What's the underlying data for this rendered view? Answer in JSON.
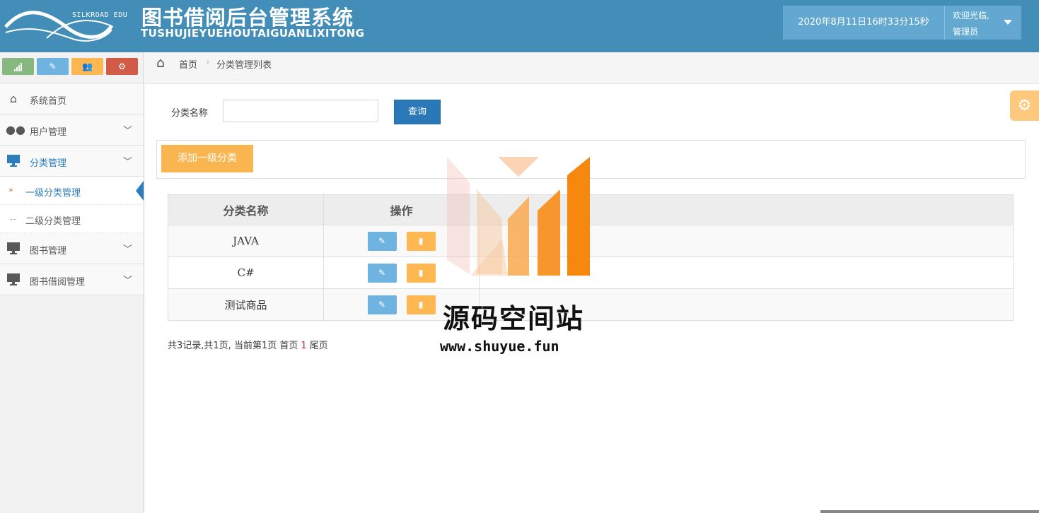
{
  "header": {
    "logo_text": "SILKROAD EDU",
    "title": "图书借阅后台管理系统",
    "subtitle": "TUSHUJIEYUEHOUTAIGUANLIXITONG",
    "datetime": "2020年8月11日16时33分15秒",
    "welcome": "欢迎光临,",
    "role": "管理员"
  },
  "shortcuts": [
    {
      "icon": "signal-icon",
      "color": "#87b87f"
    },
    {
      "icon": "pencil-icon",
      "color": "#6fb3e0"
    },
    {
      "icon": "users-icon",
      "color": "#ffb752"
    },
    {
      "icon": "cogs-icon",
      "color": "#d15b47"
    }
  ],
  "sidebar": {
    "items": [
      {
        "label": "系统首页",
        "icon": "home-icon"
      },
      {
        "label": "用户管理",
        "icon": "users-icon"
      },
      {
        "label": "分类管理",
        "icon": "desktop-icon"
      },
      {
        "label": "图书管理",
        "icon": "desktop-icon"
      },
      {
        "label": "图书借阅管理",
        "icon": "desktop-icon"
      }
    ],
    "subitems": [
      {
        "label": "一级分类管理"
      },
      {
        "label": "二级分类管理"
      }
    ]
  },
  "breadcrumb": {
    "home": "首页",
    "current": "分类管理列表"
  },
  "search": {
    "label": "分类名称",
    "value": "",
    "button": "查询"
  },
  "toolbar": {
    "add_label": "添加一级分类"
  },
  "table": {
    "headers": [
      "分类名称",
      "操作"
    ],
    "rows": [
      {
        "name": "JAVA"
      },
      {
        "name": "C#"
      },
      {
        "name": "测试商品"
      }
    ]
  },
  "pagination": {
    "summary": "共3记录,共1页, 当前第1页 首页",
    "current_page": "1",
    "last": "尾页"
  },
  "watermark": {
    "title": "源码空间站",
    "url": "www.shuyue.fun"
  }
}
